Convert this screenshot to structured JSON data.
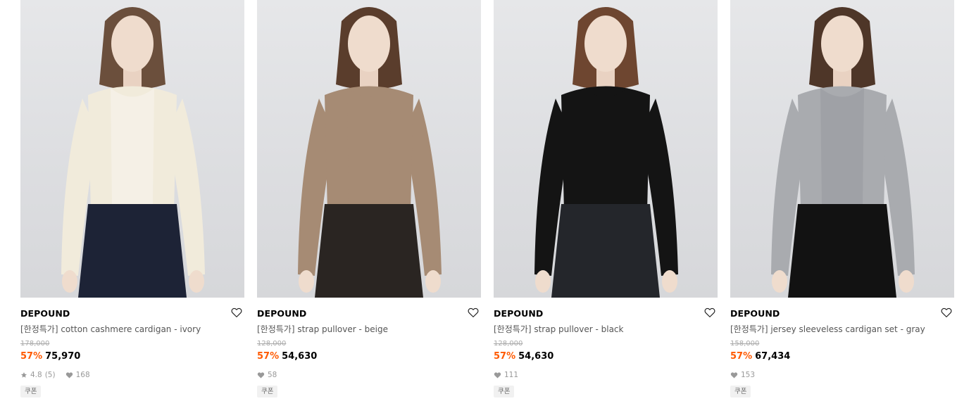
{
  "products": [
    {
      "brand": "DEPOUND",
      "name": "[한정특가] cotton cashmere cardigan - ivory",
      "original_price": "178,000",
      "discount": "57%",
      "price": "75,970",
      "rating": "4.8",
      "review_count": "(5)",
      "likes": "168",
      "coupon": "쿠폰",
      "colors": {
        "top": "#f1ebdb",
        "inner": "#f5f0e6",
        "bottom": "#1d2336",
        "hair": "#6b4f3c"
      }
    },
    {
      "brand": "DEPOUND",
      "name": "[한정특가] strap pullover - beige",
      "original_price": "128,000",
      "discount": "57%",
      "price": "54,630",
      "likes": "58",
      "coupon": "쿠폰",
      "colors": {
        "top": "#a68b74",
        "inner": "#a68b74",
        "bottom": "#2a2522",
        "hair": "#5a3d2c"
      }
    },
    {
      "brand": "DEPOUND",
      "name": "[한정특가] strap pullover - black",
      "original_price": "128,000",
      "discount": "57%",
      "price": "54,630",
      "likes": "111",
      "coupon": "쿠폰",
      "colors": {
        "top": "#141414",
        "inner": "#141414",
        "bottom": "#24262b",
        "hair": "#6e4630"
      }
    },
    {
      "brand": "DEPOUND",
      "name": "[한정특가] jersey sleeveless cardigan set - gray",
      "original_price": "158,000",
      "discount": "57%",
      "price": "67,434",
      "likes": "153",
      "coupon": "쿠폰",
      "colors": {
        "top": "#a9abaf",
        "inner": "#9fa1a6",
        "bottom": "#121212",
        "hair": "#4e3628"
      }
    }
  ]
}
